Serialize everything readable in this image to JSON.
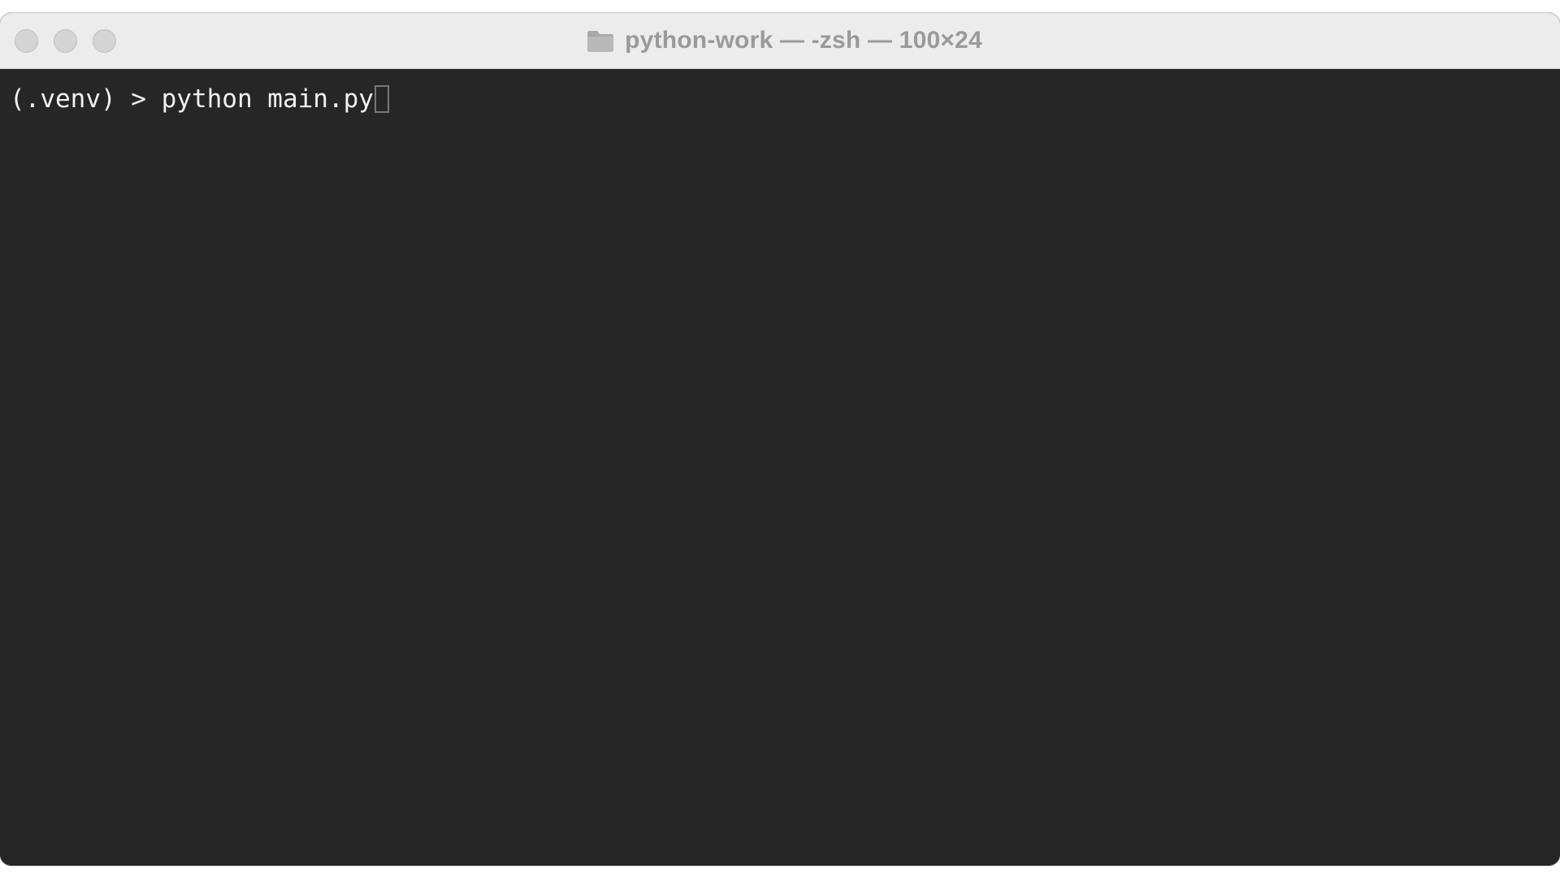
{
  "window": {
    "title": "python-work — -zsh — 100×24",
    "title_icon": "folder-icon",
    "controls": [
      {
        "name": "close-button",
        "icon": "close-icon",
        "color": "#d4d4d4"
      },
      {
        "name": "minimize-button",
        "icon": "minimize-icon",
        "color": "#d4d4d4"
      },
      {
        "name": "zoom-button",
        "icon": "zoom-icon",
        "color": "#d4d4d4"
      }
    ]
  },
  "terminal": {
    "background": "#262626",
    "foreground": "#f1f1f1",
    "prompt": "(.venv) > ",
    "command": "python main.py"
  }
}
